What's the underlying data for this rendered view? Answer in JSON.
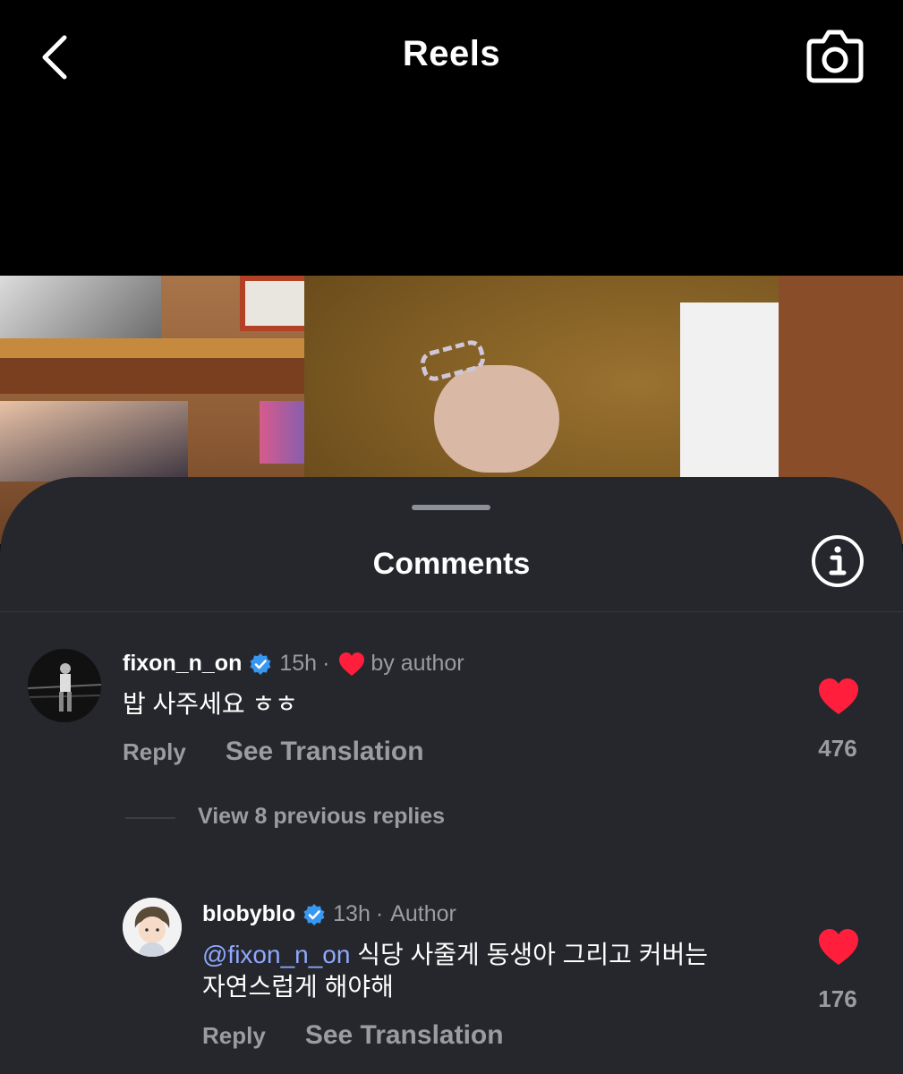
{
  "header": {
    "title": "Reels",
    "back_icon": "chevron-left-icon",
    "camera_icon": "camera-icon"
  },
  "sheet": {
    "title": "Comments",
    "info_icon": "info-icon"
  },
  "comments": [
    {
      "username": "fixon_n_on",
      "verified": true,
      "time": "15h",
      "separator": "·",
      "liked_by_author": "by author",
      "text": "밥 사주세요 ㅎㅎ",
      "reply_label": "Reply",
      "translate_label": "See Translation",
      "likes": "476"
    }
  ],
  "view_replies": "View 8 previous replies",
  "replies": [
    {
      "username": "blobyblo",
      "verified": true,
      "time": "13h",
      "separator": "·",
      "role": "Author",
      "mention": "@fixon_n_on",
      "text_line1": " 식당 사줄게 동생아 그리고 커버는",
      "text_line2": "자연스럽게 해야해",
      "reply_label": "Reply",
      "translate_label": "See Translation",
      "likes": "176"
    }
  ],
  "colors": {
    "accent_heart": "#ff1f3d",
    "verified": "#3897f0",
    "mention": "#8fa8ff",
    "sheet_bg": "#25272c"
  }
}
